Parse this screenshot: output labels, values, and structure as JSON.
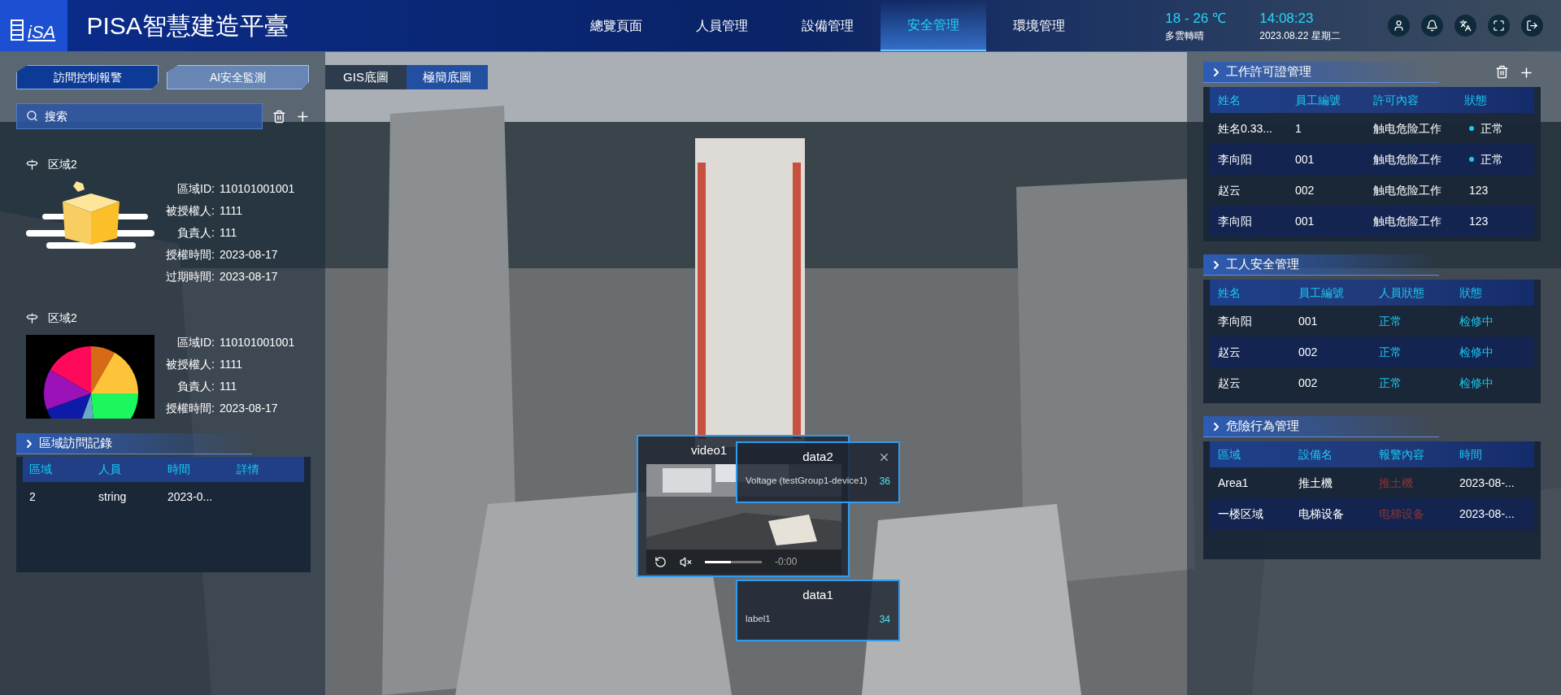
{
  "header": {
    "logo": "iSA",
    "title": "PISA智慧建造平臺",
    "nav": [
      {
        "label": "總覽頁面",
        "selected": false
      },
      {
        "label": "人員管理",
        "selected": false
      },
      {
        "label": "設備管理",
        "selected": false
      },
      {
        "label": "安全管理",
        "selected": true
      },
      {
        "label": "環境管理",
        "selected": false
      }
    ],
    "weather": {
      "temperature": "18 - 26 ℃",
      "condition": "多雲轉晴"
    },
    "clock": {
      "time": "14:08:23",
      "date": "2023.08.22 星期二"
    }
  },
  "left_tabs": [
    {
      "label": "訪問控制報警",
      "selected": true
    },
    {
      "label": "AI安全監測",
      "selected": false
    }
  ],
  "search": {
    "placeholder": "搜索"
  },
  "regions": [
    {
      "name": "区域2",
      "kind": "box",
      "fields": [
        {
          "label": "區域ID:",
          "value": "110101001001"
        },
        {
          "label": "被授權人:",
          "value": "1111"
        },
        {
          "label": "負責人:",
          "value": "111"
        },
        {
          "label": "授權時間:",
          "value": "2023-08-17"
        },
        {
          "label": "过期時間:",
          "value": "2023-08-17"
        }
      ]
    },
    {
      "name": "区域2",
      "kind": "picture",
      "fields": [
        {
          "label": "區域ID:",
          "value": "110101001001"
        },
        {
          "label": "被授權人:",
          "value": "1111"
        },
        {
          "label": "負責人:",
          "value": "111"
        },
        {
          "label": "授權時間:",
          "value": "2023-08-17"
        }
      ]
    }
  ],
  "access_log": {
    "title": "區域訪問記錄",
    "columns": [
      "區域",
      "人員",
      "時間",
      "詳情"
    ],
    "rows": [
      [
        "2",
        "string",
        "2023-0..."
      ]
    ]
  },
  "map_tabs": [
    {
      "label": "GIS底圖",
      "selected": false
    },
    {
      "label": "極簡底圖",
      "selected": true
    }
  ],
  "permits": {
    "title": "工作許可證管理",
    "columns": [
      "姓名",
      "員工編號",
      "許可內容",
      "狀態"
    ],
    "rows": [
      {
        "cells": [
          "姓名0.33...",
          "1",
          "触电危险工作"
        ],
        "status": "正常",
        "dot": true
      },
      {
        "cells": [
          "李向阳",
          "001",
          "触电危险工作"
        ],
        "status": "正常",
        "dot": true
      },
      {
        "cells": [
          "赵云",
          "002",
          "触电危险工作"
        ],
        "status": "123",
        "dot": false
      },
      {
        "cells": [
          "李向阳",
          "001",
          "触电危险工作"
        ],
        "status": "123",
        "dot": false
      }
    ]
  },
  "worker_safety": {
    "title": "工人安全管理",
    "columns": [
      "姓名",
      "員工編號",
      "人員狀態",
      "狀態"
    ],
    "rows": [
      [
        "李向阳",
        "001",
        "正常",
        "检修中"
      ],
      [
        "赵云",
        "002",
        "正常",
        "检修中"
      ],
      [
        "赵云",
        "002",
        "正常",
        "检修中"
      ]
    ]
  },
  "hazards": {
    "title": "危險行為管理",
    "columns": [
      "區域",
      "設備名",
      "報警內容",
      "時間"
    ],
    "rows": [
      [
        "Area1",
        "推土機",
        "推土機",
        "2023-08-..."
      ],
      [
        "一楼区域",
        "电梯设备",
        "电梯设备",
        "2023-08-..."
      ]
    ]
  },
  "video_popup": {
    "title": "video1",
    "time": "-0:00",
    "slider": {
      "level": 0.45
    }
  },
  "data_popups": [
    {
      "title": "data2",
      "label": "Voltage (testGroup1-device1)",
      "value": "36",
      "closable": true
    },
    {
      "title": "data1",
      "label": "label1",
      "value": "34",
      "closable": false
    }
  ]
}
